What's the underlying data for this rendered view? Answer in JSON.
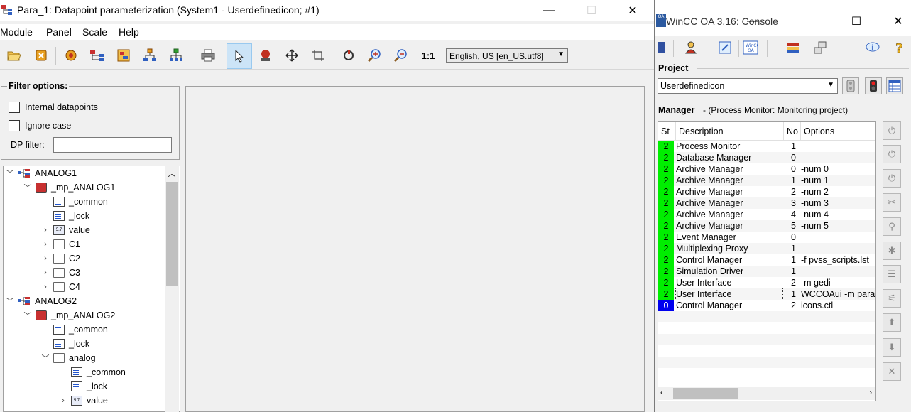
{
  "para": {
    "title": "Para_1: Datapoint parameterization (System1 - Userdefinedicon; #1)",
    "window_controls": {
      "minimize": "—",
      "maximize": "☐",
      "close": "✕"
    },
    "menu": [
      "Module",
      "Panel",
      "Scale",
      "Help"
    ],
    "toolbar": {
      "icons": [
        "open-icon",
        "close-module-icon",
        "settings-icon",
        "dp-type-icon",
        "dp-icon",
        "hierarchy-icon",
        "tree-icon",
        "print-icon",
        "select-arrow-icon",
        "config-icon",
        "move-icon",
        "crop-icon",
        "refresh-icon",
        "zoom-in-icon",
        "zoom-out-icon",
        "actual-size-icon"
      ],
      "actual_size_label": "1:1",
      "language": "English, US [en_US.utf8]"
    },
    "filter": {
      "legend": "Filter options:",
      "internal_datapoints": "Internal datapoints",
      "ignore_case": "Ignore case",
      "dp_filter_label": "DP filter:",
      "dp_filter_value": ""
    },
    "tree": [
      {
        "label": "ANALOG1",
        "icon": "dp-type",
        "chev": "﹀",
        "level": 0
      },
      {
        "label": "_mp_ANALOG1",
        "icon": "mp",
        "chev": "﹀",
        "level": 1
      },
      {
        "label": "_common",
        "icon": "element",
        "chev": "",
        "level": 2
      },
      {
        "label": "_lock",
        "icon": "element",
        "chev": "",
        "level": 2
      },
      {
        "label": "value",
        "icon": "value",
        "chev": "›",
        "level": 2
      },
      {
        "label": "C1",
        "icon": "folder",
        "chev": "›",
        "level": 2
      },
      {
        "label": "C2",
        "icon": "folder",
        "chev": "›",
        "level": 2
      },
      {
        "label": "C3",
        "icon": "folder",
        "chev": "›",
        "level": 2
      },
      {
        "label": "C4",
        "icon": "folder",
        "chev": "›",
        "level": 2
      },
      {
        "label": "ANALOG2",
        "icon": "dp-type",
        "chev": "﹀",
        "level": 0
      },
      {
        "label": "_mp_ANALOG2",
        "icon": "mp",
        "chev": "﹀",
        "level": 1
      },
      {
        "label": "_common",
        "icon": "element",
        "chev": "",
        "level": 2
      },
      {
        "label": "_lock",
        "icon": "element",
        "chev": "",
        "level": 2
      },
      {
        "label": "analog",
        "icon": "folder",
        "chev": "﹀",
        "level": 2
      },
      {
        "label": "_common",
        "icon": "element",
        "chev": "",
        "level": 3
      },
      {
        "label": "_lock",
        "icon": "element",
        "chev": "",
        "level": 3
      },
      {
        "label": "value",
        "icon": "value",
        "chev": "›",
        "level": 3
      }
    ]
  },
  "console": {
    "title": "WinCC OA 3.16: Console",
    "window_controls": {
      "minimize": "—",
      "maximize": "☐",
      "close": "✕"
    },
    "toolbar_icons": [
      "book-icon",
      "users-icon",
      "edit-icon",
      "wincc-oa-icon",
      "db-icon",
      "network-icon",
      "info-icon",
      "help-icon"
    ],
    "project_label": "Project",
    "project_value": "Userdefinedicon",
    "manager_label": "Manager",
    "manager_subtitle": "- (Process Monitor: Monitoring project)",
    "columns": [
      "St",
      "Description",
      "No",
      "Options"
    ],
    "managers": [
      {
        "st": "2",
        "status": "green",
        "desc": "Process Monitor",
        "no": "1",
        "opt": ""
      },
      {
        "st": "2",
        "status": "green",
        "desc": "Database Manager",
        "no": "0",
        "opt": ""
      },
      {
        "st": "2",
        "status": "green",
        "desc": "Archive Manager",
        "no": "0",
        "opt": "-num 0"
      },
      {
        "st": "2",
        "status": "green",
        "desc": "Archive Manager",
        "no": "1",
        "opt": "-num 1"
      },
      {
        "st": "2",
        "status": "green",
        "desc": "Archive Manager",
        "no": "2",
        "opt": "-num 2"
      },
      {
        "st": "2",
        "status": "green",
        "desc": "Archive Manager",
        "no": "3",
        "opt": "-num 3"
      },
      {
        "st": "2",
        "status": "green",
        "desc": "Archive Manager",
        "no": "4",
        "opt": "-num 4"
      },
      {
        "st": "2",
        "status": "green",
        "desc": "Archive Manager",
        "no": "5",
        "opt": "-num 5"
      },
      {
        "st": "2",
        "status": "green",
        "desc": "Event Manager",
        "no": "0",
        "opt": ""
      },
      {
        "st": "2",
        "status": "green",
        "desc": "Multiplexing Proxy",
        "no": "1",
        "opt": ""
      },
      {
        "st": "2",
        "status": "green",
        "desc": "Control Manager",
        "no": "1",
        "opt": "-f pvss_scripts.lst"
      },
      {
        "st": "2",
        "status": "green",
        "desc": "Simulation Driver",
        "no": "1",
        "opt": ""
      },
      {
        "st": "2",
        "status": "green",
        "desc": "User Interface",
        "no": "2",
        "opt": "-m gedi"
      },
      {
        "st": "2",
        "status": "green",
        "desc": "User Interface",
        "no": "1",
        "opt": "WCCOAui -m para"
      },
      {
        "st": "0",
        "status": "blue",
        "desc": "Control Manager",
        "no": "2",
        "opt": "icons.ctl"
      }
    ],
    "side_buttons": [
      "start-all-icon",
      "stop-all-icon",
      "restart-icon",
      "settings-tools-icon",
      "search-icon",
      "debug-icon",
      "log-icon",
      "plug-icon",
      "move-up-icon",
      "move-down-icon",
      "remove-icon"
    ],
    "colors": {
      "running": "#00ee00",
      "stopped": "#0000ee"
    }
  }
}
